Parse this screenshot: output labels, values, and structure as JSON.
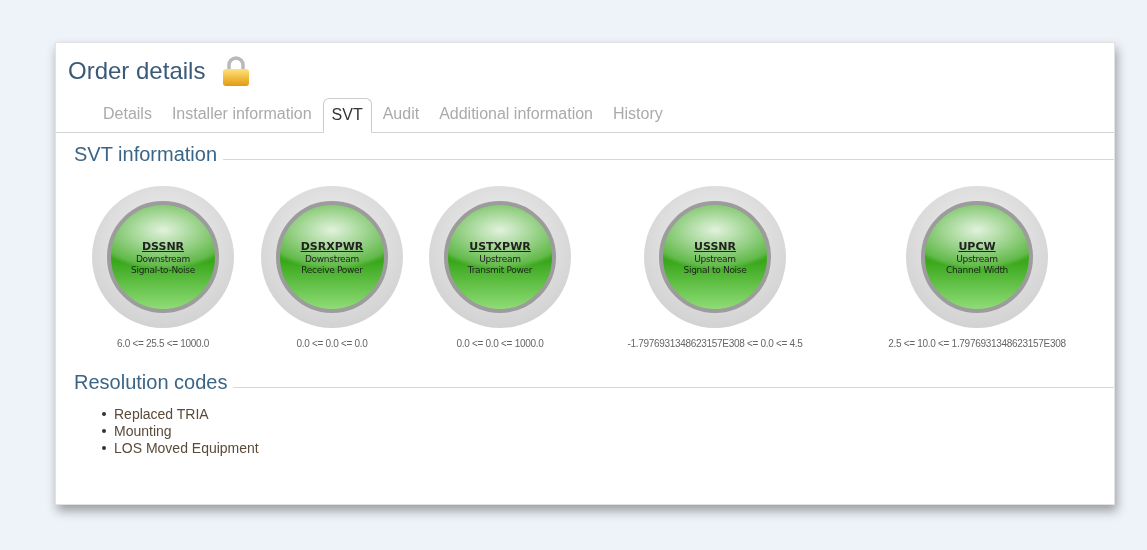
{
  "title": "Order details",
  "tabs": [
    {
      "label": "Details",
      "selected": false
    },
    {
      "label": "Installer information",
      "selected": false
    },
    {
      "label": "SVT",
      "selected": true
    },
    {
      "label": "Audit",
      "selected": false
    },
    {
      "label": "Additional information",
      "selected": false
    },
    {
      "label": "History",
      "selected": false
    }
  ],
  "svt_section": {
    "heading": "SVT information",
    "gauges": [
      {
        "code": "DSSNR",
        "description": [
          "Downstream",
          "Signal-to-Noise"
        ],
        "color": "#3aa81c",
        "range": "6.0 <= 25.5 <= 1000.0"
      },
      {
        "code": "DSRXPWR",
        "description": [
          "Downstream",
          "Receive Power"
        ],
        "color": "#3aa81c",
        "range": "0.0 <= 0.0 <= 0.0"
      },
      {
        "code": "USTXPWR",
        "description": [
          "Upstream",
          "Transmit Power"
        ],
        "color": "#3aa81c",
        "range": "0.0 <= 0.0 <= 1000.0"
      },
      {
        "code": "USSNR",
        "description": [
          "Upstream",
          "Signal to Noise"
        ],
        "color": "#3aa81c",
        "range": "-1.7976931348623157E308 <= 0.0 <= 4.5"
      },
      {
        "code": "UPCW",
        "description": [
          "Upstream",
          "Channel Width"
        ],
        "color": "#3aa81c",
        "range": "2.5 <= 10.0 <= 1.7976931348623157E308"
      }
    ]
  },
  "resolution_section": {
    "heading": "Resolution codes",
    "items": [
      "Replaced TRIA",
      "Mounting",
      "LOS Moved Equipment"
    ]
  }
}
